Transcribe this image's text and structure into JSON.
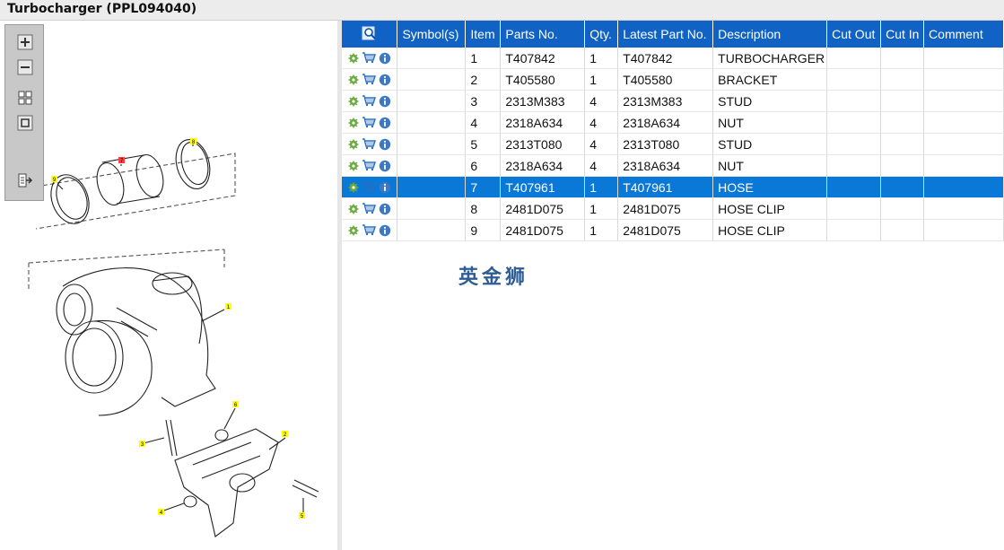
{
  "window": {
    "title": "Turbocharger (PPL094040)"
  },
  "zoom_toolbar": {
    "buttons": [
      {
        "name": "zoom-in-icon"
      },
      {
        "name": "zoom-out-icon"
      },
      {
        "name": "fit-page-icon"
      },
      {
        "name": "actual-size-icon"
      },
      {
        "name": "export-icon"
      }
    ]
  },
  "diagram": {
    "callouts": [
      "1",
      "2",
      "3",
      "4",
      "5",
      "6",
      "7",
      "8",
      "9"
    ]
  },
  "table": {
    "headers": [
      "",
      "Symbol(s)",
      "Item",
      "Parts No.",
      "Qty.",
      "Latest Part No.",
      "Description",
      "Cut Out",
      "Cut In",
      "Comment"
    ],
    "rows": [
      {
        "item": "1",
        "part_no": "T407842",
        "qty": "1",
        "latest": "T407842",
        "desc": "TURBOCHARGER"
      },
      {
        "item": "2",
        "part_no": "T405580",
        "qty": "1",
        "latest": "T405580",
        "desc": "BRACKET"
      },
      {
        "item": "3",
        "part_no": "2313M383",
        "qty": "4",
        "latest": "2313M383",
        "desc": "STUD"
      },
      {
        "item": "4",
        "part_no": "2318A634",
        "qty": "4",
        "latest": "2318A634",
        "desc": "NUT"
      },
      {
        "item": "5",
        "part_no": "2313T080",
        "qty": "4",
        "latest": "2313T080",
        "desc": "STUD"
      },
      {
        "item": "6",
        "part_no": "2318A634",
        "qty": "4",
        "latest": "2318A634",
        "desc": "NUT"
      },
      {
        "item": "7",
        "part_no": "T407961",
        "qty": "1",
        "latest": "T407961",
        "desc": "HOSE"
      },
      {
        "item": "8",
        "part_no": "2481D075",
        "qty": "1",
        "latest": "2481D075",
        "desc": "HOSE CLIP"
      },
      {
        "item": "9",
        "part_no": "2481D075",
        "qty": "1",
        "latest": "2481D075",
        "desc": "HOSE CLIP"
      }
    ],
    "selected_item": "7"
  },
  "watermark": "英金狮",
  "colors": {
    "header_bg": "#1062c4",
    "selected_row": "#0a78d7",
    "callout_yellow": "#ffff00",
    "callout_red": "#ff3b3b"
  }
}
